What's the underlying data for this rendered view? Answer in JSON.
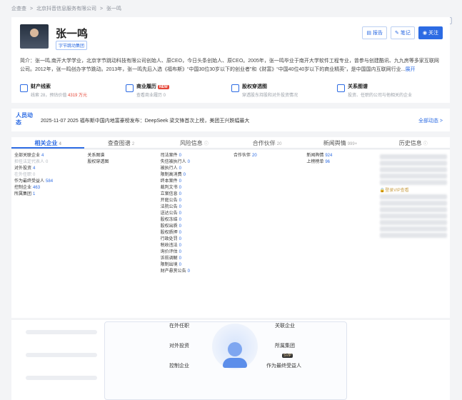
{
  "breadcrumb": [
    "企查查",
    ">",
    "北京抖音信息服务有限公司",
    ">",
    "张一鸣"
  ],
  "person": {
    "name": "张一鸣",
    "tag": "字节跳动集团",
    "bio": "简介：张一鸣,南开大学学业，北京字节跳动科技有限公司创始人、原CEO，今日头条创始人、原CEO。2005年，张一鸣毕业于南开大学软件工程专业，曾参与创建酷讯、九九房等多家互联网公司。2012年，张一鸣创办字节跳动。2013年，张一鸣先后入选《福布斯》“中国30位30岁以下的创业者”和《财富》“中国40位40岁以下的商业精英”，是中国国内互联网行业...",
    "bio_more": "展开"
  },
  "actions": {
    "report": "报告",
    "note": "笔记",
    "follow": "关注"
  },
  "stats": [
    {
      "title": "财产线索",
      "sub_prefix": "线索 28，预估价值 ",
      "sub_value": "4319 万元"
    },
    {
      "title": "商业履历",
      "badge": "NEW",
      "sub": "查看商业履历 0"
    },
    {
      "title": "股权穿透图",
      "sub": "穿透股东持股和对外投资情况"
    },
    {
      "title": "关系图谱",
      "sub": "投资、任职的公司与他相关的企业"
    }
  ],
  "dynamics": {
    "logo": "人员动态",
    "text": "2025-11-07 2025 福布斯中国内地富豪榜发布：DeepSeek 梁文锋首次上榜，美团王兴跌幅最大",
    "link": "全部动态 >"
  },
  "tabs": [
    {
      "label": "相关企业",
      "count": "4"
    },
    {
      "label": "查查图谱",
      "count": "2"
    },
    {
      "label": "风险信息",
      "count": ""
    },
    {
      "label": "合作伙伴",
      "count": "20"
    },
    {
      "label": "新闻舆情",
      "count": "999+"
    },
    {
      "label": "历史信息",
      "count": ""
    }
  ],
  "col1": [
    {
      "label": "全部关联企业",
      "num": "4"
    },
    {
      "label": "担任法定代表人",
      "num": "0",
      "dim": true
    },
    {
      "label": "对外投资",
      "num": "4"
    },
    {
      "label": "在外任职",
      "num": "0",
      "dim": true
    },
    {
      "label": "作为最终受益人",
      "num": "584"
    },
    {
      "label": "控制企业",
      "num": "463"
    },
    {
      "label": "所属集团",
      "num": "1"
    }
  ],
  "col2": [
    {
      "label": "关系图谱",
      "num": ""
    },
    {
      "label": "股权穿透图",
      "num": ""
    }
  ],
  "col3": [
    {
      "label": "司法案件",
      "num": "0"
    },
    {
      "label": "失信被执行人",
      "num": "0"
    },
    {
      "label": "被执行人",
      "num": "0"
    },
    {
      "label": "限制高消费",
      "num": "0"
    },
    {
      "label": "终本案件",
      "num": "0"
    },
    {
      "label": "裁判文书",
      "num": "0"
    },
    {
      "label": "立案信息",
      "num": "0"
    },
    {
      "label": "开庭公告",
      "num": "0"
    },
    {
      "label": "法院公告",
      "num": "0"
    },
    {
      "label": "送达公告",
      "num": "0"
    },
    {
      "label": "股权冻结",
      "num": "0"
    },
    {
      "label": "股权出质",
      "num": "0"
    },
    {
      "label": "股权质押",
      "num": "0"
    },
    {
      "label": "行政处罚",
      "num": "0"
    },
    {
      "label": "税收违法",
      "num": "0"
    },
    {
      "label": "询价评估",
      "num": "0"
    },
    {
      "label": "诉前调解",
      "num": "0"
    },
    {
      "label": "限制出境",
      "num": "0"
    },
    {
      "label": "财产悬赏公告",
      "num": "0"
    }
  ],
  "col4": [
    {
      "label": "合作伙伴",
      "num": "20"
    }
  ],
  "col5": [
    {
      "label": "新闻舆情",
      "num": "924"
    },
    {
      "label": "上榜榜单",
      "num": "96"
    }
  ],
  "col6_vip": "登录VIP查看",
  "diagram": {
    "labels": [
      "在外任职",
      "关联企业",
      "对外投资",
      "所属集团",
      "控制企业",
      "作为最终受益人"
    ],
    "badge": "SVIP"
  }
}
